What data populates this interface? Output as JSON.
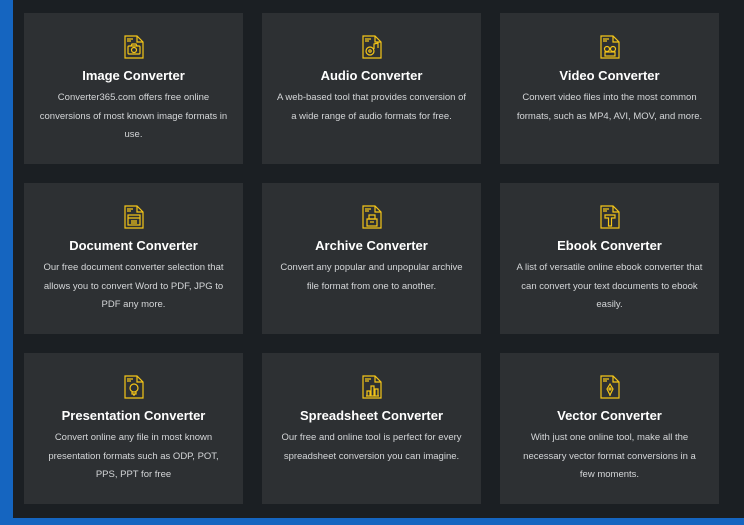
{
  "accent_color": "#f5c518",
  "cards": [
    {
      "icon": "camera-file-icon",
      "title": "Image Converter",
      "description": "Converter365.com offers free online conversions of most known image formats in use."
    },
    {
      "icon": "music-file-icon",
      "title": "Audio Converter",
      "description": "A web-based tool that provides conversion of a wide range of audio formats for free."
    },
    {
      "icon": "video-file-icon",
      "title": "Video Converter",
      "description": "Convert video files into the most common formats, such as MP4, AVI, MOV, and more."
    },
    {
      "icon": "document-file-icon",
      "title": "Document Converter",
      "description": "Our free document converter selection that allows you to convert Word to PDF, JPG to PDF any more."
    },
    {
      "icon": "archive-file-icon",
      "title": "Archive Converter",
      "description": "Convert any popular and unpopular archive file format from one to another."
    },
    {
      "icon": "ebook-file-icon",
      "title": "Ebook Converter",
      "description": "A list of versatile online ebook converter that can convert your text documents to ebook easily."
    },
    {
      "icon": "presentation-file-icon",
      "title": "Presentation Converter",
      "description": "Convert online any file in most known presentation formats such as ODP, POT, PPS, PPT for free"
    },
    {
      "icon": "spreadsheet-file-icon",
      "title": "Spreadsheet Converter",
      "description": "Our free and online tool is perfect for every spreadsheet conversion you can imagine."
    },
    {
      "icon": "vector-file-icon",
      "title": "Vector Converter",
      "description": "With just one online tool, make all the necessary vector format conversions in a few moments."
    }
  ]
}
